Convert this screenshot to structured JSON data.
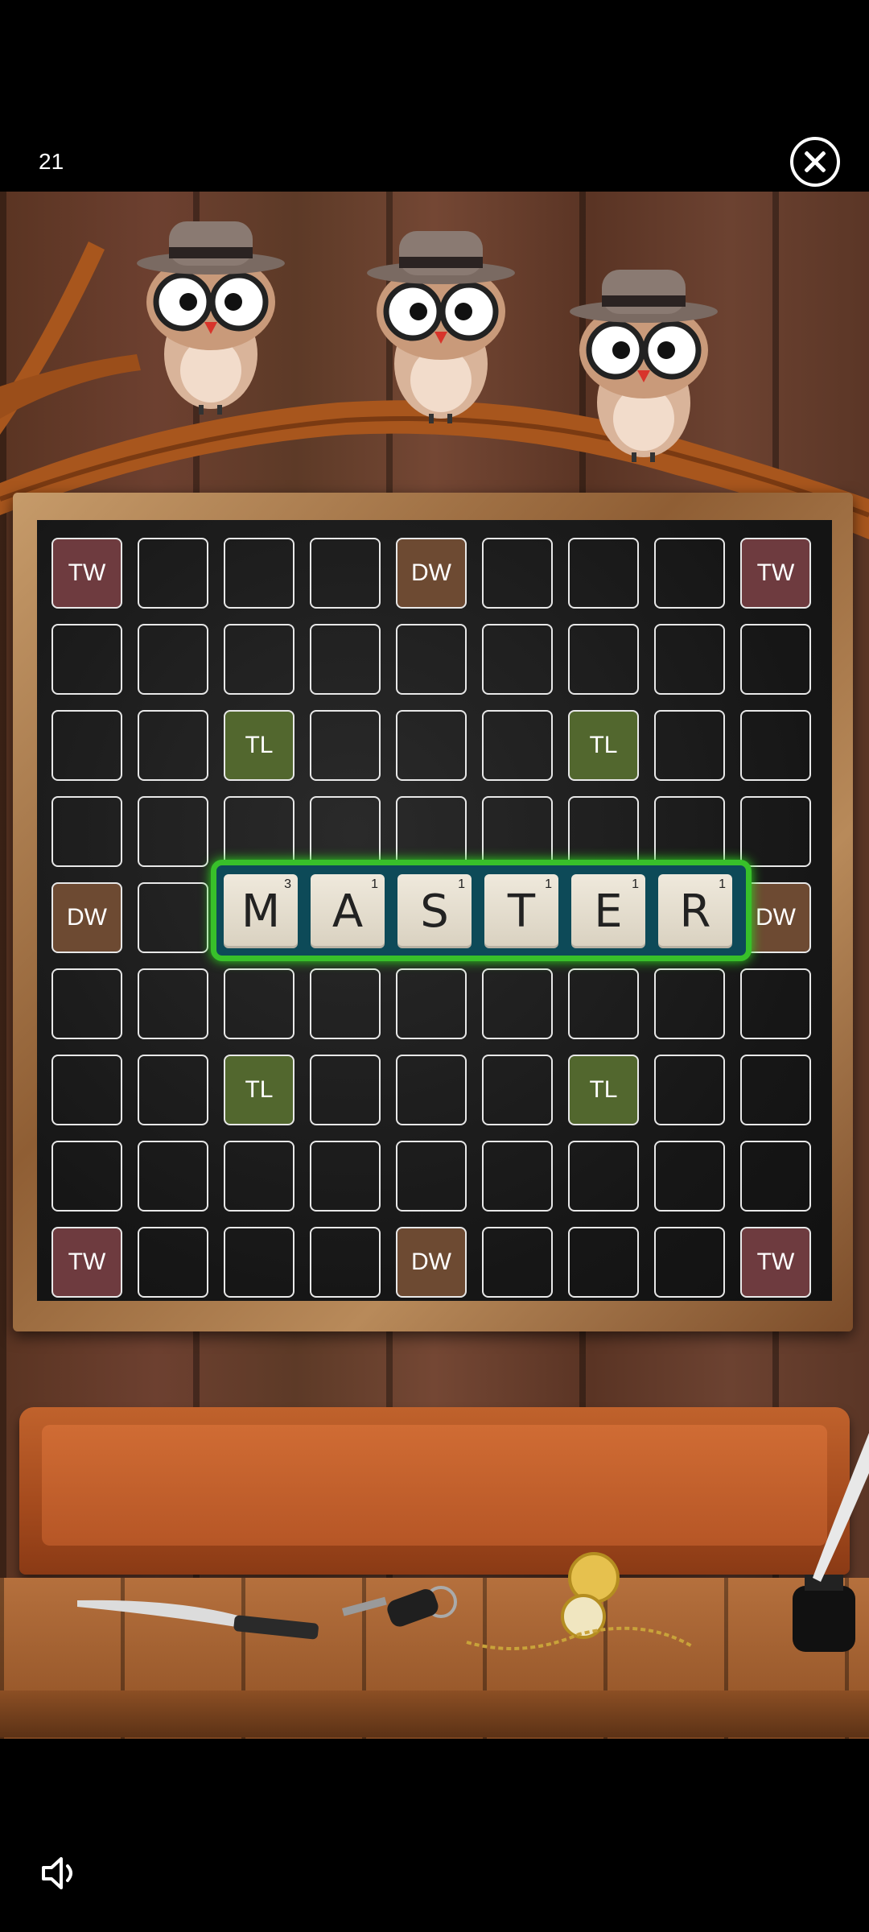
{
  "header": {
    "counter": "21"
  },
  "board": {
    "rows": [
      [
        "TW",
        "",
        "",
        "",
        "DW",
        "",
        "",
        "",
        "TW"
      ],
      [
        "",
        "",
        "",
        "",
        "",
        "",
        "",
        "",
        ""
      ],
      [
        "",
        "",
        "TL",
        "",
        "",
        "",
        "TL",
        "",
        ""
      ],
      [
        "",
        "",
        "",
        "",
        "",
        "",
        "",
        "",
        ""
      ],
      [
        "DW",
        "",
        "",
        "",
        "",
        "",
        "",
        "",
        "DW"
      ],
      [
        "",
        "",
        "",
        "",
        "",
        "",
        "",
        "",
        ""
      ],
      [
        "",
        "",
        "TL",
        "",
        "",
        "",
        "TL",
        "",
        ""
      ],
      [
        "",
        "",
        "",
        "",
        "",
        "",
        "",
        "",
        ""
      ],
      [
        "TW",
        "",
        "",
        "",
        "DW",
        "",
        "",
        "",
        "TW"
      ]
    ]
  },
  "word": {
    "tiles": [
      {
        "letter": "M",
        "points": "3"
      },
      {
        "letter": "A",
        "points": "1"
      },
      {
        "letter": "S",
        "points": "1"
      },
      {
        "letter": "T",
        "points": "1"
      },
      {
        "letter": "E",
        "points": "1"
      },
      {
        "letter": "R",
        "points": "1"
      }
    ]
  },
  "icons": {
    "close": "close-icon",
    "sound": "speaker-icon"
  },
  "colors": {
    "triple_word": "#6e3b3f",
    "double_word": "#6d4a32",
    "triple_letter": "#52672e",
    "highlight": "#38c02a"
  }
}
